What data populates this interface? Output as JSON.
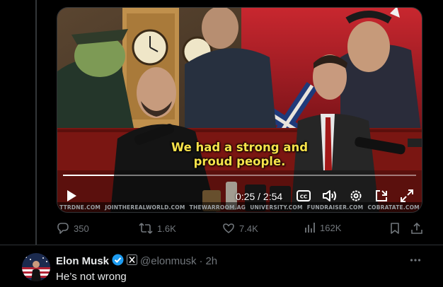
{
  "video": {
    "caption_line1": "We had a strong and",
    "caption_line2": "proud people.",
    "time": "0:25 / 2:54",
    "progress_fraction": 0.144,
    "sponsors": [
      "TTRDNE.COM",
      "JOINTHEREALWORLD.COM",
      "THEWARROOM.AG",
      "UNIVERSITY.COM",
      "FUNDRAISER.COM",
      "COBRATATE.COM"
    ]
  },
  "actions": {
    "replies": "350",
    "reposts": "1.6K",
    "likes": "7.4K",
    "views": "162K"
  },
  "reply": {
    "name": "Elon Musk",
    "handle": "@elonmusk",
    "separator": "·",
    "time": "2h",
    "text": "He’s not wrong"
  },
  "colors": {
    "background": "#000000",
    "text_primary": "#e7e9ea",
    "text_secondary": "#71767b",
    "verified_blue": "#1d9bf0",
    "caption_yellow": "#f7e24a"
  }
}
